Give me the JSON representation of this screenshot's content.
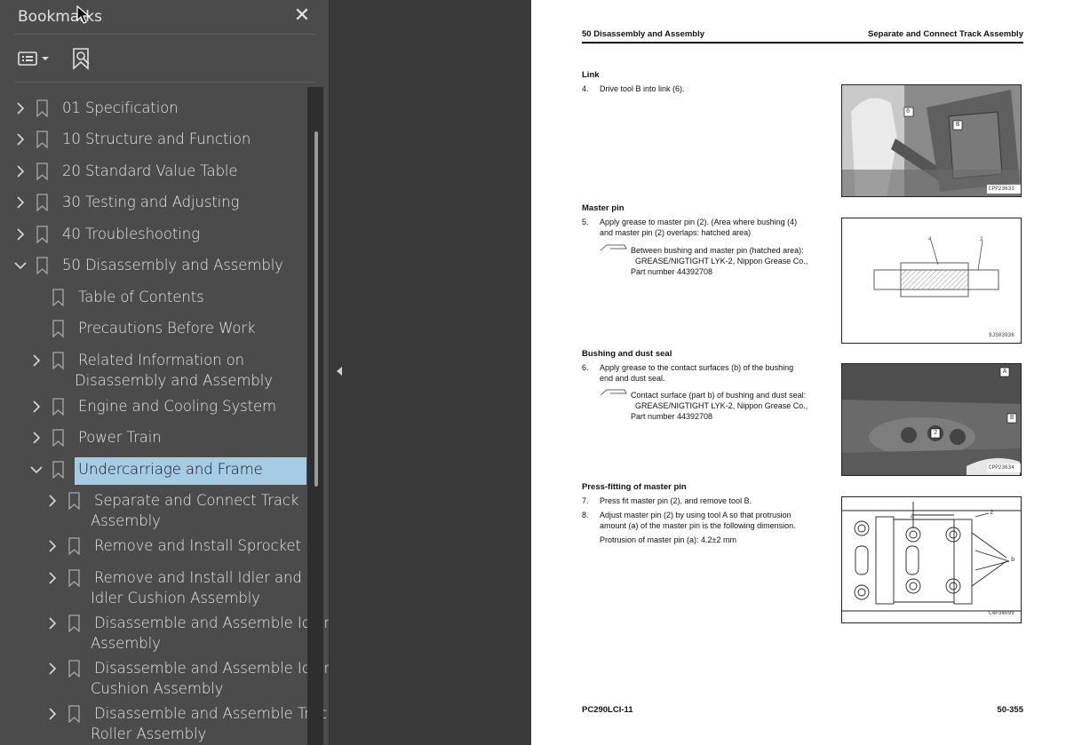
{
  "sidebar": {
    "title": "Bookmarks",
    "close_label": "✕",
    "items": [
      {
        "label": "01 Specification"
      },
      {
        "label": "10 Structure and Function"
      },
      {
        "label": "20 Standard Value Table"
      },
      {
        "label": "30 Testing and Adjusting"
      },
      {
        "label": "40 Troubleshooting"
      },
      {
        "label": "50 Disassembly and Assembly"
      },
      {
        "label": "Table of Contents"
      },
      {
        "label": "Precautions Before Work"
      },
      {
        "label": "Related Information on",
        "label2": "Disassembly and Assembly"
      },
      {
        "label": "Engine and Cooling System"
      },
      {
        "label": "Power Train"
      },
      {
        "label": "Undercarriage and Frame"
      },
      {
        "label": "Separate and Connect Track",
        "label2": "Assembly"
      },
      {
        "label": "Remove and Install Sprocket"
      },
      {
        "label": "Remove and Install Idler and",
        "label2": "Idler Cushion Assembly"
      },
      {
        "label": "Disassemble and Assemble Idler",
        "label2": "Assembly"
      },
      {
        "label": "Disassemble and Assemble Idler",
        "label2": "Cushion Assembly"
      },
      {
        "label": "Disassemble and Assemble Track",
        "label2": "Roller Assembly"
      }
    ]
  },
  "page": {
    "header_left": "50 Disassembly and Assembly",
    "header_right": "Separate and Connect Track Assembly",
    "footer_left": "PC290LCI-11",
    "footer_right": "50-355",
    "sections": {
      "link": {
        "heading": "Link",
        "step": "4.",
        "text": "Drive tool B into link (6).",
        "fig_id": "CPP23633",
        "callouts": [
          "6",
          "B"
        ]
      },
      "master_pin": {
        "heading": "Master pin",
        "step": "5.",
        "line1": "Apply grease to master pin (2). (Area where bushing (4)",
        "line2": "and master pin (2) overlaps: hatched area)",
        "note1": "Between bushing and master pin (hatched area):",
        "note2": "GREASE/NIGTIGHT LYK-2, Nippon Grease Co.,",
        "note3": "Part number 44392708",
        "fig_id": "9JS03936",
        "callouts": [
          "4",
          "2"
        ]
      },
      "bushing": {
        "heading": "Bushing and dust seal",
        "step": "6.",
        "line1": "Apply grease to the contact surfaces (b) of the bushing",
        "line2": "end and dust seal.",
        "note1": "Contact surface (part b) of bushing and dust seal:",
        "note2": "GREASE/NIGTIGHT LYK-2, Nippon Grease Co.,",
        "note3": "Part number 44392708",
        "fig_id": "CPP23634",
        "callouts": [
          "A",
          "B",
          "2"
        ]
      },
      "press_fit": {
        "heading": "Press-fitting of master pin",
        "step7": "7.",
        "line7": "Press fit master pin (2), and remove tool B.",
        "step8": "8.",
        "line8a": "Adjust master pin (2) by using tool A so that protrusion",
        "line8b": "amount (a) of the master pin is the following dimension.",
        "line8c": "Protrusion of master pin (a): 4.2±2 mm",
        "fig_id": "C4P34099",
        "callouts": [
          "a",
          "2",
          "b"
        ]
      }
    }
  }
}
